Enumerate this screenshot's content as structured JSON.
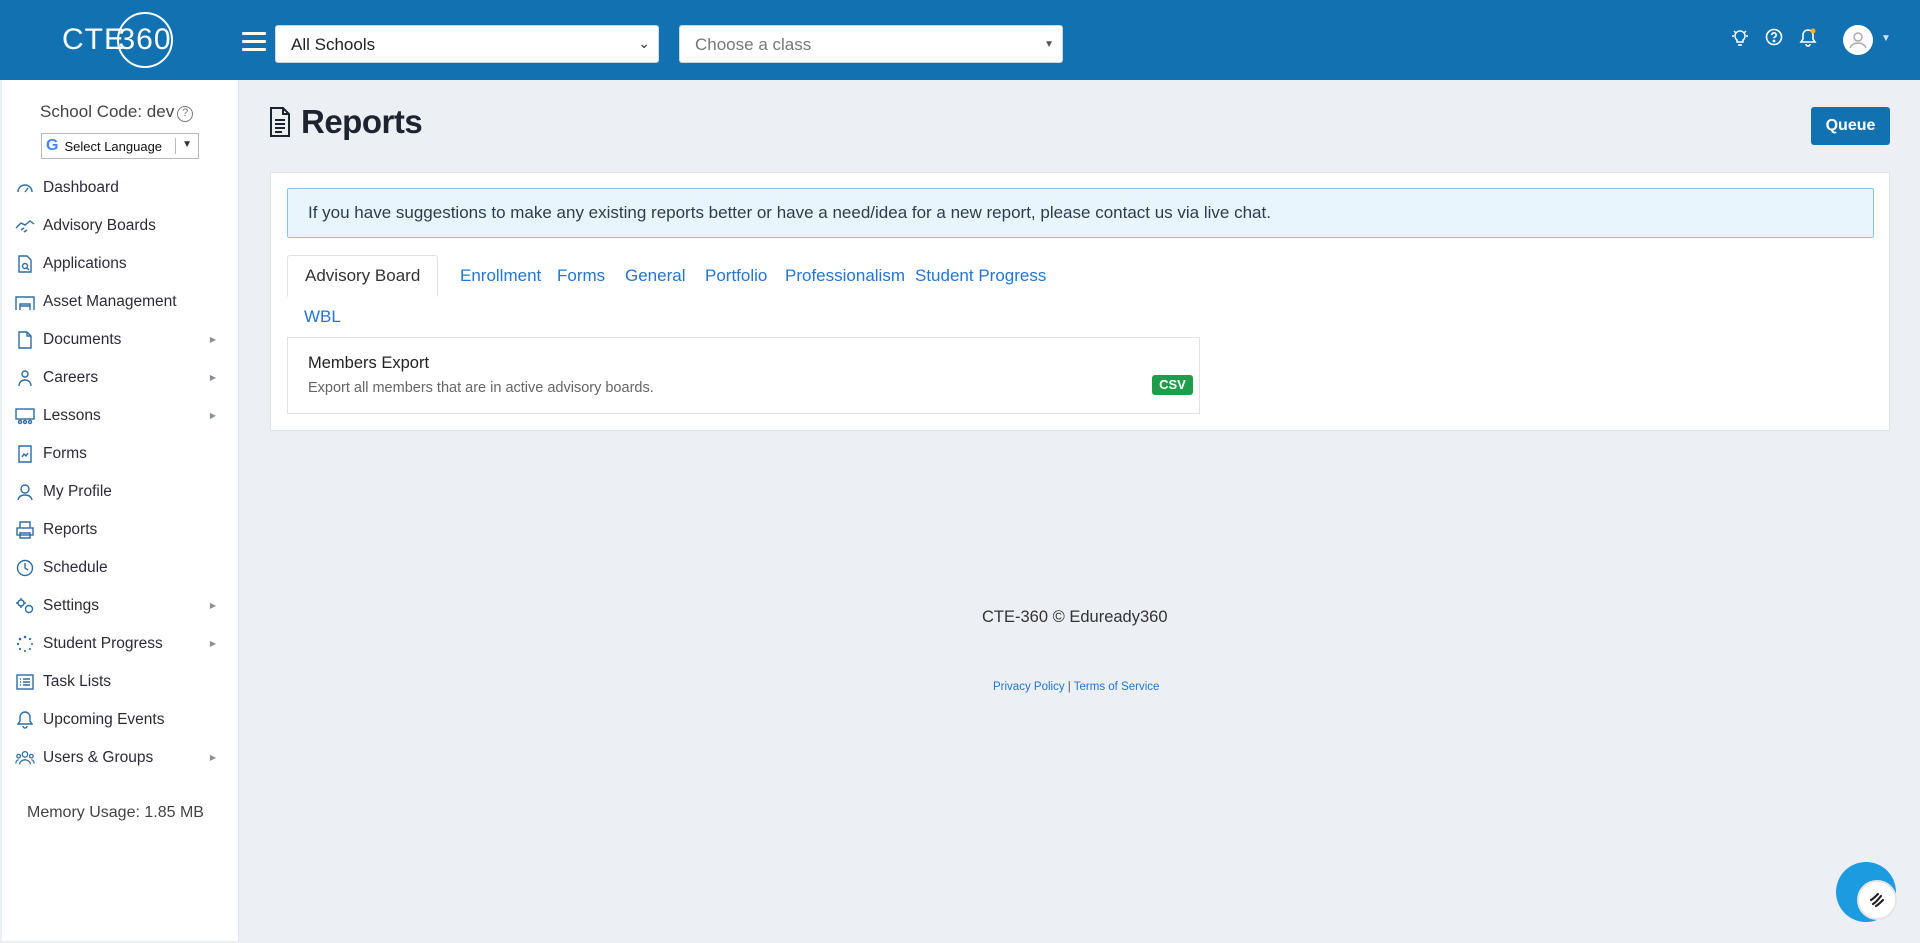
{
  "app": {
    "logo_text": "CTE",
    "logo_ring": "360"
  },
  "topbar": {
    "school_select": {
      "value": "All Schools"
    },
    "class_select": {
      "placeholder": "Choose a class"
    },
    "icons": [
      "lightbulb-icon",
      "help-icon",
      "bell-icon",
      "user-avatar"
    ]
  },
  "sidebar": {
    "school_code": "School Code: dev",
    "language_label": "Select Language",
    "items": [
      {
        "label": "Dashboard",
        "icon": "dashboard-icon",
        "has_submenu": false
      },
      {
        "label": "Advisory Boards",
        "icon": "handshake-icon",
        "has_submenu": false
      },
      {
        "label": "Applications",
        "icon": "file-search-icon",
        "has_submenu": false
      },
      {
        "label": "Asset Management",
        "icon": "warehouse-icon",
        "has_submenu": false
      },
      {
        "label": "Documents",
        "icon": "document-icon",
        "has_submenu": true
      },
      {
        "label": "Careers",
        "icon": "careers-icon",
        "has_submenu": true
      },
      {
        "label": "Lessons",
        "icon": "lessons-icon",
        "has_submenu": true
      },
      {
        "label": "Forms",
        "icon": "form-icon",
        "has_submenu": false
      },
      {
        "label": "My Profile",
        "icon": "user-icon",
        "has_submenu": false
      },
      {
        "label": "Reports",
        "icon": "printer-icon",
        "has_submenu": false
      },
      {
        "label": "Schedule",
        "icon": "clock-icon",
        "has_submenu": false
      },
      {
        "label": "Settings",
        "icon": "gears-icon",
        "has_submenu": true
      },
      {
        "label": "Student Progress",
        "icon": "spinner-icon",
        "has_submenu": true
      },
      {
        "label": "Task Lists",
        "icon": "list-icon",
        "has_submenu": false
      },
      {
        "label": "Upcoming Events",
        "icon": "bell-icon",
        "has_submenu": false
      },
      {
        "label": "Users & Groups",
        "icon": "users-icon",
        "has_submenu": true
      }
    ],
    "memory": "Memory Usage: 1.85 MB"
  },
  "main": {
    "title": "Reports",
    "queue_label": "Queue",
    "alert": "If you have suggestions to make any existing reports better or have a need/idea for a new report, please contact us via live chat.",
    "tabs": [
      {
        "label": "Advisory Board",
        "active": true
      },
      {
        "label": "Enrollment",
        "active": false
      },
      {
        "label": "Forms",
        "active": false
      },
      {
        "label": "General",
        "active": false
      },
      {
        "label": "Portfolio",
        "active": false
      },
      {
        "label": "Professionalism",
        "active": false
      },
      {
        "label": "Student Progress",
        "active": false
      },
      {
        "label": "WBL",
        "active": false
      }
    ],
    "reports": [
      {
        "title": "Members Export",
        "description": "Export all members that are in active advisory boards.",
        "format": "CSV"
      }
    ]
  },
  "footer": {
    "copyright": "CTE-360 © Eduready360",
    "privacy": "Privacy Policy",
    "separator": "|",
    "terms": "Terms of Service"
  },
  "colors": {
    "brand": "#1272b1",
    "link": "#2475d4",
    "csv_badge": "#1e9e4a",
    "alert_bg": "#e8f5fd",
    "page_bg": "#eceff4"
  }
}
